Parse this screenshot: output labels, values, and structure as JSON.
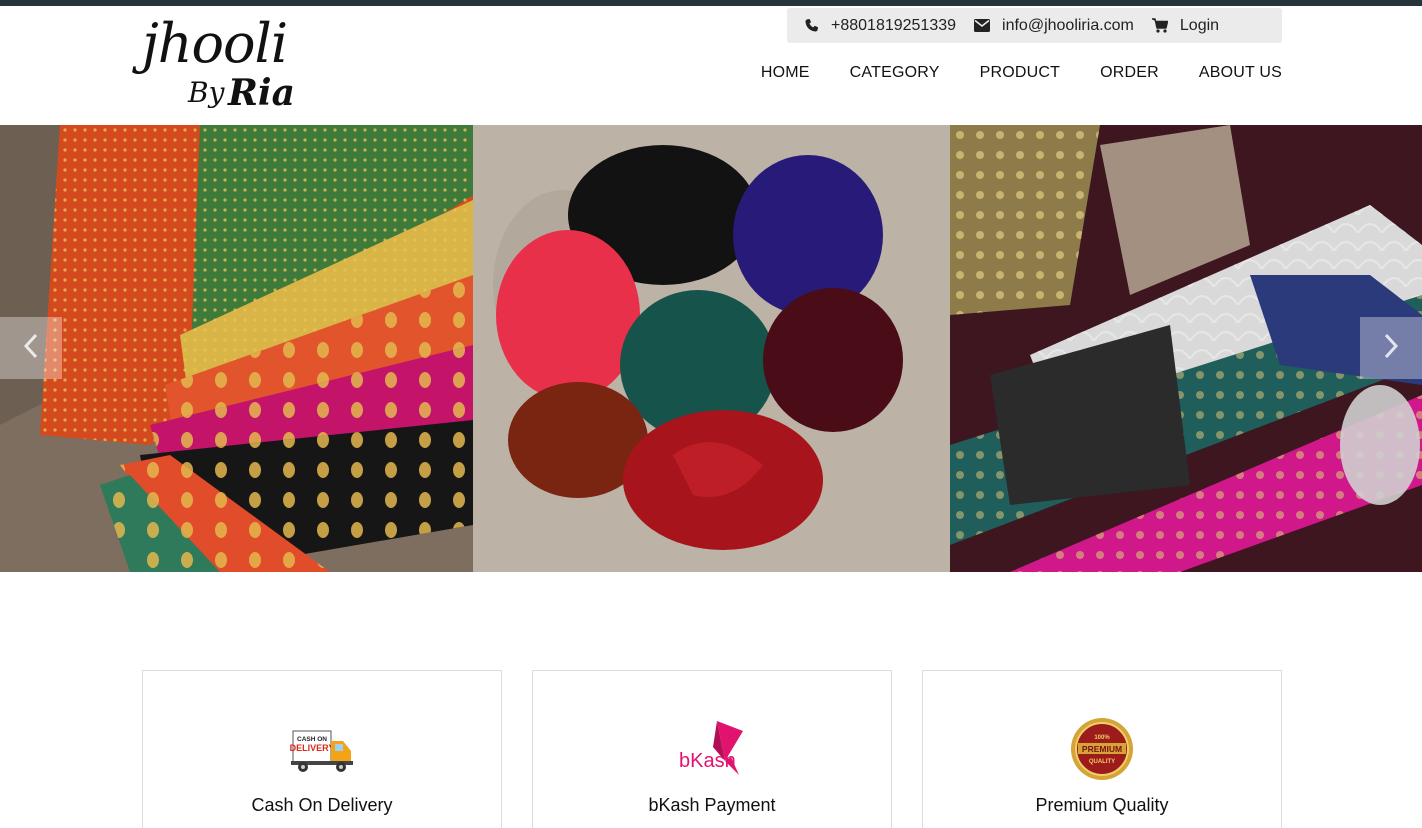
{
  "brand": {
    "logo_main": "jhooli",
    "logo_by": "By",
    "logo_ria": "Ria"
  },
  "contact": {
    "phone": "+8801819251339",
    "email": "info@jhooliria.com",
    "login_label": "Login",
    "icons": [
      "phone-icon",
      "envelope-icon",
      "cart-icon"
    ]
  },
  "nav": {
    "items": [
      "HOME",
      "CATEGORY",
      "PRODUCT",
      "ORDER",
      "ABOUT US"
    ]
  },
  "hero": {
    "slides": [
      "brocade-fabrics",
      "velvet-fabric-rolls",
      "lace-trim-rolls"
    ],
    "controls": [
      "chevron-left-icon",
      "chevron-right-icon"
    ]
  },
  "features": [
    {
      "title": "Cash On Delivery",
      "icon": "delivery-truck-icon",
      "icon_text": [
        "CASH ON",
        "DELIVERY"
      ]
    },
    {
      "title": "bKash Payment",
      "icon": "bkash-logo-icon",
      "icon_text": [
        "bKash"
      ]
    },
    {
      "title": "Premium Quality",
      "icon": "premium-badge-icon",
      "icon_text": [
        "100%",
        "PREMIUM",
        "QUALITY"
      ]
    }
  ],
  "colors": {
    "top_strip": "#27343a",
    "contact_bg": "#ebebeb",
    "bkash_pink": "#e2136e",
    "badge_red": "#9e1b1b",
    "badge_gold": "#d4a437"
  }
}
